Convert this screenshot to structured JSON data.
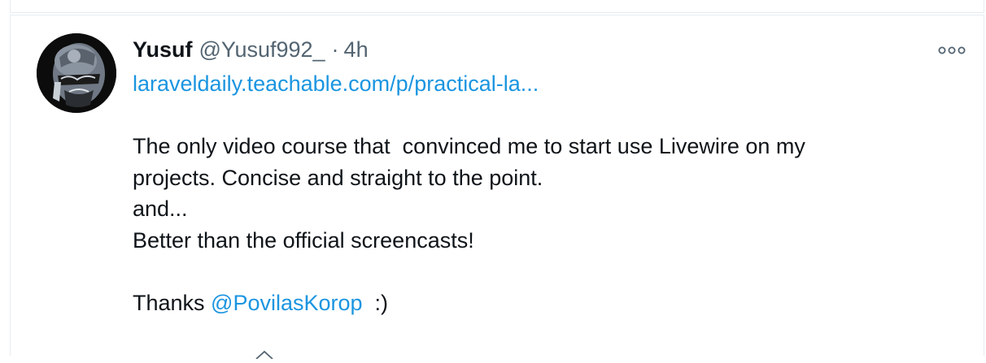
{
  "tweet": {
    "author_name": "Yusuf",
    "handle": "@Yusuf992_",
    "separator": "·",
    "time": "4h",
    "link_text": "laraveldaily.teachable.com/p/practical-la...",
    "lines": [
      "The only video course that  convinced me to start use Livewire on my",
      "projects. Concise and straight to the point.",
      "and...",
      "Better than the official screencasts!"
    ],
    "thanks_prefix": "Thanks ",
    "mention": "@PovilasKorop",
    "thanks_suffix": "  :)",
    "more_icon": "more-horizontal-icon"
  },
  "colors": {
    "link": "#1b95e0",
    "secondary_text": "#536471",
    "border": "#e6ecf0"
  }
}
